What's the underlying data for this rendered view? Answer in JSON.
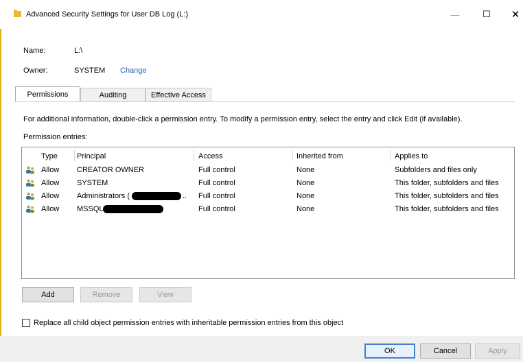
{
  "window": {
    "title": "Advanced Security Settings for User DB Log (L:)",
    "minimize": "—",
    "maximize": "☐",
    "close": "✕"
  },
  "info": {
    "name_label": "Name:",
    "name_value": "L:\\",
    "owner_label": "Owner:",
    "owner_value": "SYSTEM",
    "owner_change": "Change"
  },
  "tabs": [
    {
      "label": "Permissions",
      "active": true
    },
    {
      "label": "Auditing",
      "active": false
    },
    {
      "label": "Effective Access",
      "active": false
    }
  ],
  "instructions": "For additional information, double-click a permission entry. To modify a permission entry, select the entry and click Edit (if available).",
  "entries_label": "Permission entries:",
  "columns": [
    "Type",
    "Principal",
    "Access",
    "Inherited from",
    "Applies to"
  ],
  "rows": [
    {
      "type": "Allow",
      "principal": "CREATOR OWNER",
      "access": "Full control",
      "inherited": "None",
      "applies": "Subfolders and files only"
    },
    {
      "type": "Allow",
      "principal": "SYSTEM",
      "access": "Full control",
      "inherited": "None",
      "applies": "This folder, subfolders and files"
    },
    {
      "type": "Allow",
      "principal": "Administrators (",
      "access": "Full control",
      "inherited": "None",
      "applies": "This folder, subfolders and files"
    },
    {
      "type": "Allow",
      "principal": "MSSQLS",
      "access": "Full control",
      "inherited": "None",
      "applies": "This folder, subfolders and files"
    }
  ],
  "row_ellipsis": "..",
  "actions": {
    "add": "Add",
    "remove": "Remove",
    "view": "View"
  },
  "replace_label": "Replace all child object permission entries with inheritable permission entries from this object",
  "footer": {
    "ok": "OK",
    "cancel": "Cancel",
    "apply": "Apply"
  },
  "icons": {
    "user": "users-icon",
    "folder": "folder-icon"
  },
  "colors": {
    "link": "#1a5fb4",
    "default_button_border": "#4a7fd0"
  }
}
